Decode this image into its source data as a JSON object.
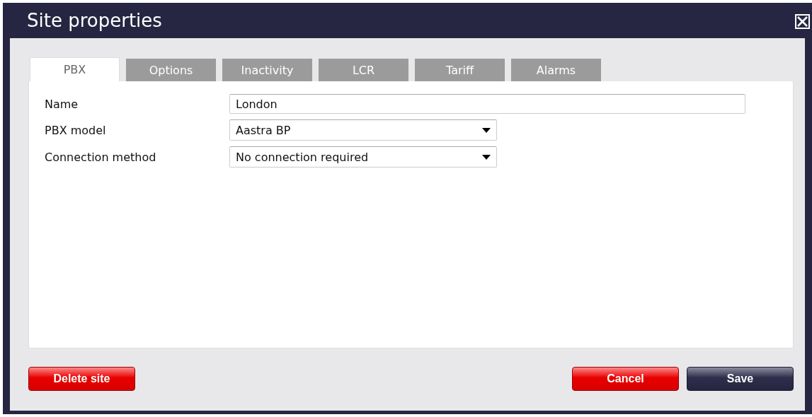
{
  "window": {
    "title": "Site properties"
  },
  "tabs": [
    {
      "label": "PBX",
      "selected": true
    },
    {
      "label": "Options",
      "selected": false
    },
    {
      "label": "Inactivity",
      "selected": false
    },
    {
      "label": "LCR",
      "selected": false
    },
    {
      "label": "Tariff",
      "selected": false
    },
    {
      "label": "Alarms",
      "selected": false
    }
  ],
  "fields": [
    {
      "label": "Name",
      "kind": "text",
      "value": "London"
    },
    {
      "label": "PBX model",
      "kind": "select",
      "value": "Aastra BP"
    },
    {
      "label": "Connection method",
      "kind": "select",
      "value": "No connection required"
    }
  ],
  "buttons": [
    {
      "label": "Delete site",
      "kind": "danger"
    },
    {
      "label": "Cancel",
      "kind": "danger"
    },
    {
      "label": "Save",
      "kind": "primary"
    }
  ]
}
